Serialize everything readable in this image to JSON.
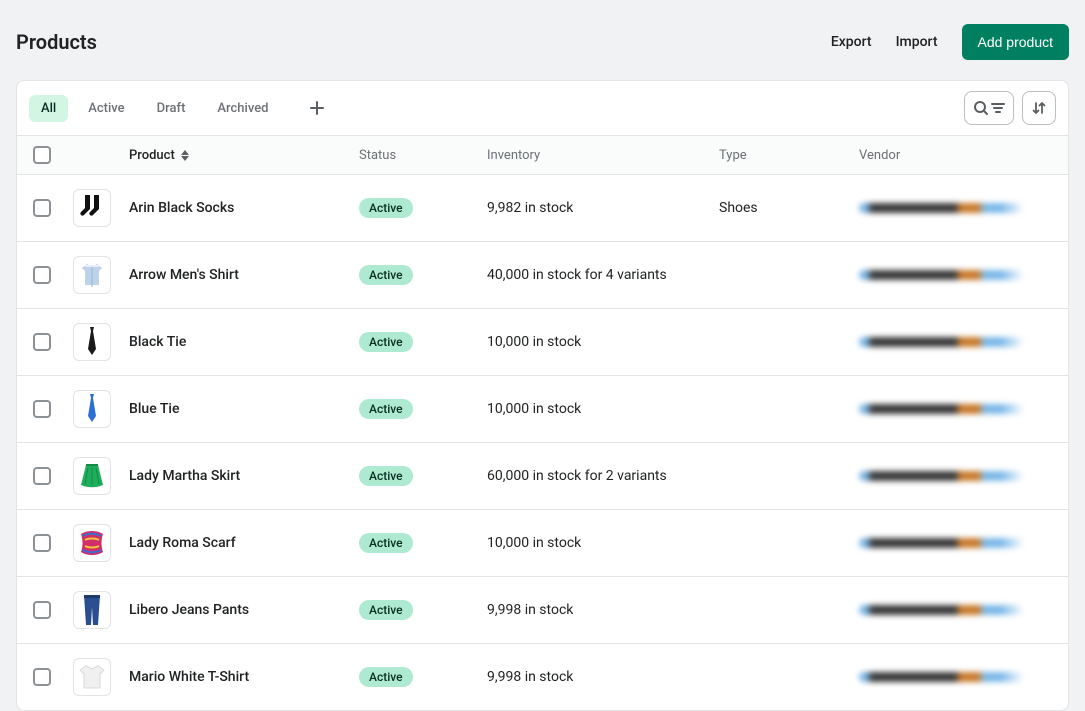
{
  "header": {
    "title": "Products",
    "export": "Export",
    "import": "Import",
    "add_product": "Add product"
  },
  "tabs": {
    "items": [
      {
        "label": "All",
        "active": true
      },
      {
        "label": "Active",
        "active": false
      },
      {
        "label": "Draft",
        "active": false
      },
      {
        "label": "Archived",
        "active": false
      }
    ]
  },
  "columns": {
    "product": "Product",
    "status": "Status",
    "inventory": "Inventory",
    "type": "Type",
    "vendor": "Vendor"
  },
  "rows": [
    {
      "name": "Arin Black Socks",
      "status": "Active",
      "inventory": "9,982 in stock",
      "type": "Shoes",
      "thumb": "socks"
    },
    {
      "name": "Arrow Men's Shirt",
      "status": "Active",
      "inventory": "40,000 in stock for 4 variants",
      "type": "",
      "thumb": "shirt"
    },
    {
      "name": "Black Tie",
      "status": "Active",
      "inventory": "10,000 in stock",
      "type": "",
      "thumb": "blacktie"
    },
    {
      "name": "Blue Tie",
      "status": "Active",
      "inventory": "10,000 in stock",
      "type": "",
      "thumb": "bluetie"
    },
    {
      "name": "Lady Martha Skirt",
      "status": "Active",
      "inventory": "60,000 in stock for 2 variants",
      "type": "",
      "thumb": "skirt"
    },
    {
      "name": "Lady Roma Scarf",
      "status": "Active",
      "inventory": "10,000 in stock",
      "type": "",
      "thumb": "scarf"
    },
    {
      "name": "Libero Jeans Pants",
      "status": "Active",
      "inventory": "9,998 in stock",
      "type": "",
      "thumb": "jeans"
    },
    {
      "name": "Mario White T-Shirt",
      "status": "Active",
      "inventory": "9,998 in stock",
      "type": "",
      "thumb": "tshirt"
    }
  ]
}
